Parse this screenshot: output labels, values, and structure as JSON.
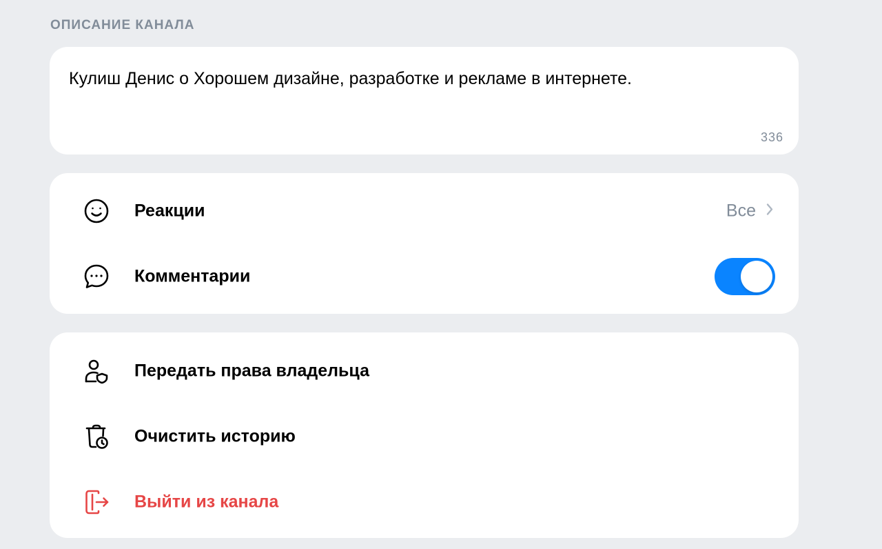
{
  "description_section": {
    "header": "ОПИСАНИЕ КАНАЛА",
    "text": "Кулиш Денис о Хорошем дизайне, разработке и рекламе в интернете.",
    "counter": "336"
  },
  "settings": {
    "reactions": {
      "label": "Реакции",
      "value": "Все",
      "icon": "smile-icon"
    },
    "comments": {
      "label": "Комментарии",
      "enabled": true,
      "icon": "chat-bubble-icon"
    }
  },
  "actions": {
    "transfer": {
      "label": "Передать права владельца",
      "icon": "user-shield-icon"
    },
    "clear_history": {
      "label": "Очистить историю",
      "icon": "trash-clock-icon"
    },
    "leave": {
      "label": "Выйти из канала",
      "icon": "exit-icon",
      "color": "#e64646"
    }
  },
  "colors": {
    "background": "#ebedf0",
    "card": "#ffffff",
    "accent": "#0a84ff",
    "secondary_text": "#818c99",
    "danger": "#e64646"
  }
}
